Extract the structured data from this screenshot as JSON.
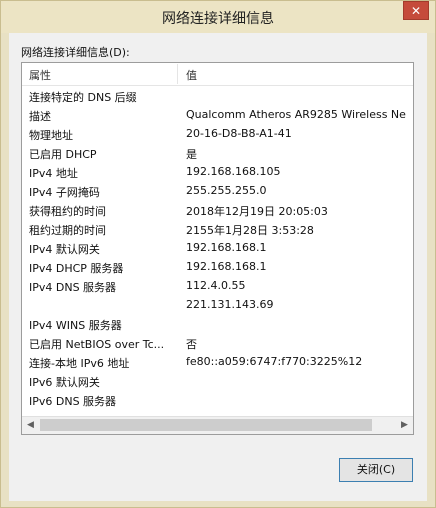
{
  "window": {
    "title": "网络连接详细信息",
    "close_glyph": "✕"
  },
  "details_label": "网络连接详细信息(D):",
  "table": {
    "headers": {
      "property": "属性",
      "value": "值"
    },
    "rows": [
      {
        "property": "连接特定的 DNS 后缀",
        "value": ""
      },
      {
        "property": "描述",
        "value": "Qualcomm Atheros AR9285 Wireless Ne"
      },
      {
        "property": "物理地址",
        "value": "20-16-D8-B8-A1-41"
      },
      {
        "property": "已启用 DHCP",
        "value": "是"
      },
      {
        "property": "IPv4 地址",
        "value": "192.168.168.105"
      },
      {
        "property": "IPv4 子网掩码",
        "value": "255.255.255.0"
      },
      {
        "property": "获得租约的时间",
        "value": "2018年12月19日 20:05:03"
      },
      {
        "property": "租约过期的时间",
        "value": "2155年1月28日 3:53:28"
      },
      {
        "property": "IPv4 默认网关",
        "value": "192.168.168.1"
      },
      {
        "property": "IPv4 DHCP 服务器",
        "value": "192.168.168.1"
      },
      {
        "property": "IPv4 DNS 服务器",
        "value": "112.4.0.55"
      },
      {
        "property": "",
        "value": "221.131.143.69"
      },
      {
        "property": "IPv4 WINS 服务器",
        "value": ""
      },
      {
        "property": "已启用 NetBIOS over Tc...",
        "value": "否"
      },
      {
        "property": "连接-本地 IPv6 地址",
        "value": "fe80::a059:6747:f770:3225%12"
      },
      {
        "property": "IPv6 默认网关",
        "value": ""
      },
      {
        "property": "IPv6 DNS 服务器",
        "value": ""
      }
    ]
  },
  "scrollbar": {
    "left_glyph": "◀",
    "right_glyph": "▶"
  },
  "close_button_label": "关闭(C)"
}
